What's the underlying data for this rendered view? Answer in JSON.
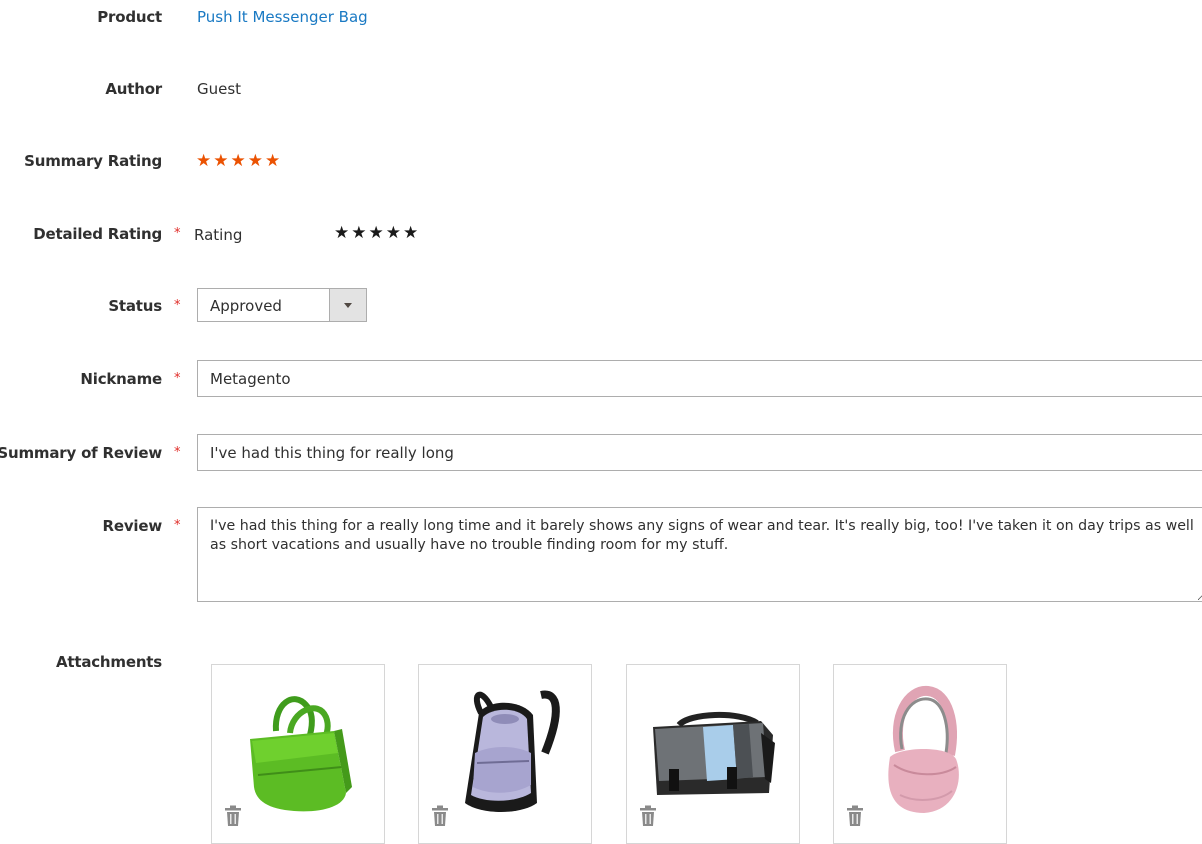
{
  "product": {
    "label": "Product",
    "value": "Push It Messenger Bag"
  },
  "author": {
    "label": "Author",
    "value": "Guest"
  },
  "summary_rating": {
    "label": "Summary Rating",
    "stars": "★★★★★",
    "color": "#eb5202"
  },
  "detailed_rating": {
    "label": "Detailed Rating",
    "required_mark": "*",
    "sub_label": "Rating",
    "stars": "★★★★★"
  },
  "status": {
    "label": "Status",
    "required_mark": "*",
    "selected": "Approved"
  },
  "nickname": {
    "label": "Nickname",
    "required_mark": "*",
    "value": "Metagento"
  },
  "summary_of_review": {
    "label": "Summary of Review",
    "required_mark": "*",
    "value": "I've had this thing for really long"
  },
  "review": {
    "label": "Review",
    "required_mark": "*",
    "value": "I've had this thing for a really long time and it barely shows any signs of wear and tear. It's really big, too! I've taken it on day trips as well as short vacations and usually have no trouble finding room for my stuff."
  },
  "attachments": {
    "label": "Attachments",
    "items": [
      {
        "icon": "green-duffle-bag-icon",
        "delete_icon": "trash-icon"
      },
      {
        "icon": "lavender-backpack-icon",
        "delete_icon": "trash-icon"
      },
      {
        "icon": "gray-messenger-bag-icon",
        "delete_icon": "trash-icon"
      },
      {
        "icon": "pink-shoulder-bag-icon",
        "delete_icon": "trash-icon"
      }
    ]
  },
  "colors": {
    "link": "#1979c3",
    "required": "#e02b27",
    "star_summary": "#eb5202",
    "border": "#adadad"
  }
}
